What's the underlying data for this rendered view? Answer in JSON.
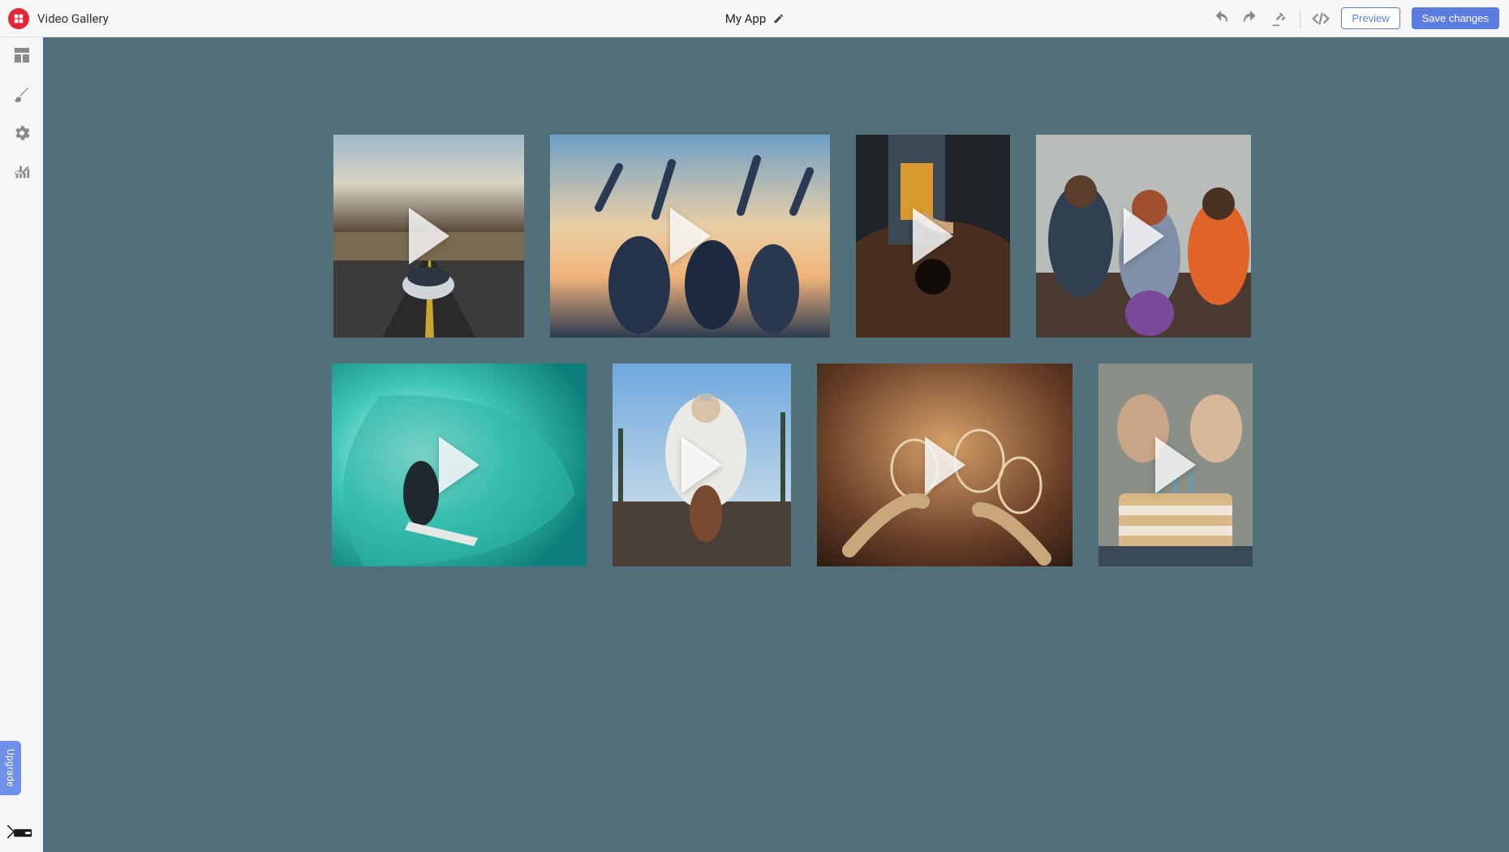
{
  "header": {
    "page_name": "Video Gallery",
    "app_title": "My App",
    "buttons": {
      "preview": "Preview",
      "save": "Save changes"
    }
  },
  "sidebar": {
    "upgrade_label": "Upgrade"
  },
  "gallery": {
    "row1": [
      {
        "id": "car-road"
      },
      {
        "id": "friends-sunset"
      },
      {
        "id": "guitar"
      },
      {
        "id": "friends-sitting"
      }
    ],
    "row2": [
      {
        "id": "surfer-wave"
      },
      {
        "id": "skateboarder"
      },
      {
        "id": "wine-toast"
      },
      {
        "id": "kids-birthday-cake"
      }
    ]
  }
}
